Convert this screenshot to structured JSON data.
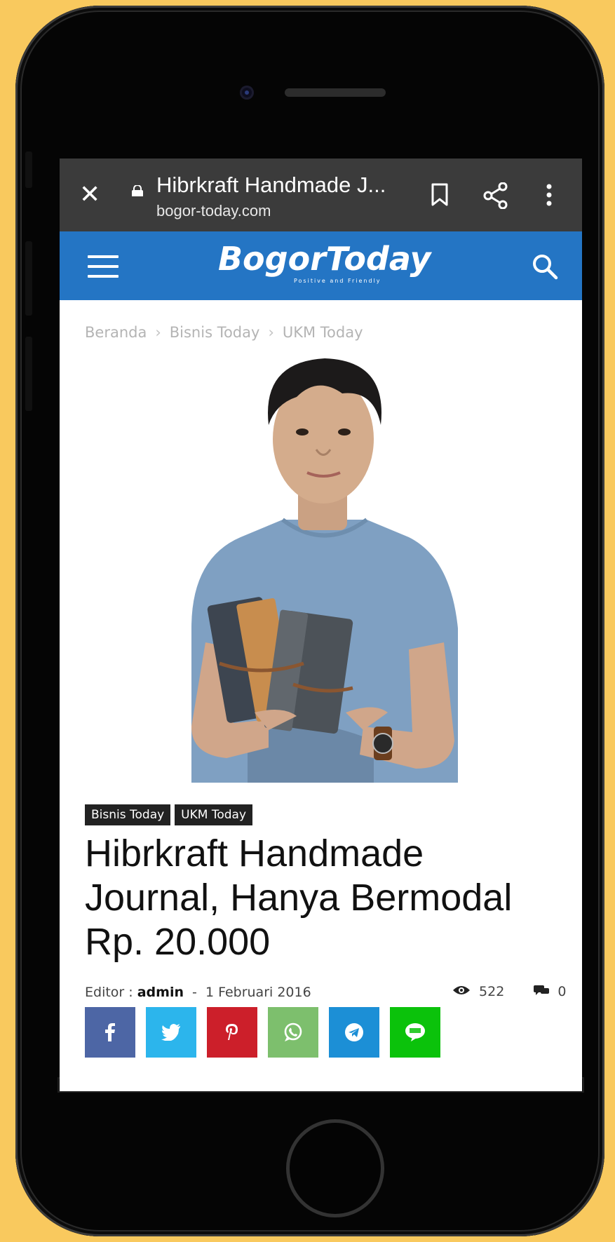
{
  "browser": {
    "close_glyph": "✕",
    "page_title": "Hibrkraft Handmade J...",
    "url": "bogor-today.com"
  },
  "site": {
    "logo": "BogorToday",
    "tagline": "Positive and Friendly"
  },
  "breadcrumb": [
    "Beranda",
    "Bisnis Today",
    "UKM Today"
  ],
  "breadcrumb_separator": "›",
  "article": {
    "categories": [
      "Bisnis Today",
      "UKM Today"
    ],
    "title": "Hibrkraft Handmade Journal, Hanya Bermodal Rp. 20.000",
    "editor_label": "Editor :",
    "editor": "admin",
    "date_separator": "-",
    "date": "1 Februari 2016",
    "views": "522",
    "comments": "0"
  },
  "share_buttons": [
    {
      "name": "facebook",
      "color": "#3b5998",
      "icon": "facebook-icon"
    },
    {
      "name": "twitter",
      "color": "#1da1f2",
      "icon": "twitter-icon"
    },
    {
      "name": "pinterest",
      "color": "#cb2027",
      "icon": "pinterest-icon"
    },
    {
      "name": "whatsapp",
      "color": "#7bbf6a",
      "icon": "whatsapp-icon"
    },
    {
      "name": "telegram",
      "color": "#179cde",
      "icon": "telegram-icon"
    },
    {
      "name": "line",
      "color": "#00c300",
      "icon": "line-icon"
    }
  ],
  "colors": {
    "page_background": "#f9c95e",
    "browser_bar": "#3b3b3b",
    "header": "#2475c4"
  }
}
